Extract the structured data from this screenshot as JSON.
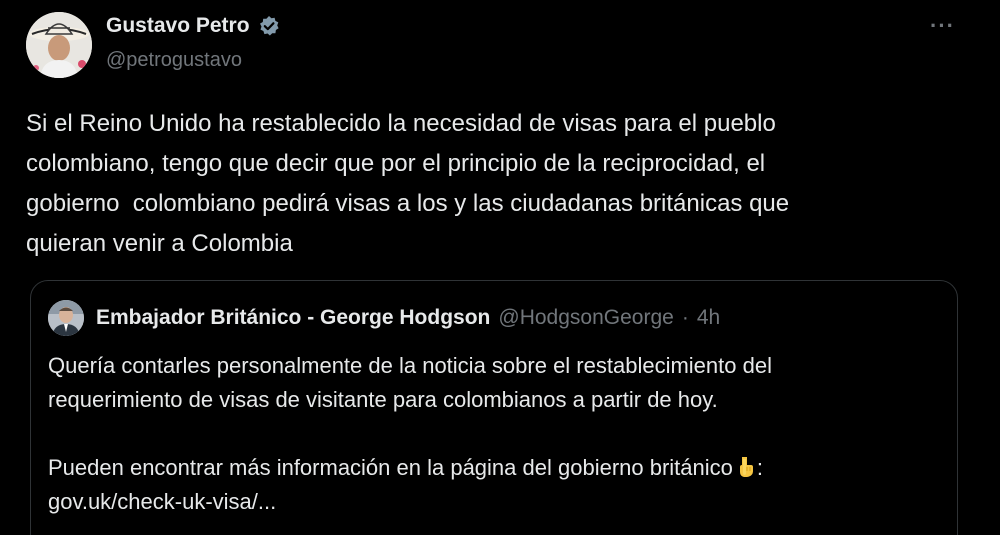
{
  "author": {
    "display_name": "Gustavo Petro",
    "handle": "@petrogustavo",
    "verified_icon": "verified-badge-icon"
  },
  "menu": {
    "more_label": "···"
  },
  "tweet": {
    "text": "Si el Reino Unido ha restablecido la necesidad de visas para el pueblo\ncolombiano, tengo que decir que por el principio de la reciprocidad, el\ngobierno  colombiano pedirá visas a los y las ciudadanas británicas que\nquieran venir a Colombia"
  },
  "quote": {
    "display_name": "Embajador Británico - George Hodgson",
    "handle": "@HodgsonGeorge",
    "separator": "·",
    "time": "4h",
    "paragraph1_line1": "Quería contarles personalmente de la noticia sobre el restablecimiento del",
    "paragraph1_line2": "requerimiento de visas de visitante para colombianos a partir de hoy.",
    "paragraph2_text": "Pueden encontrar más información en la página del gobierno británico",
    "paragraph2_emoji": "pointing-down-hand-icon",
    "paragraph2_colon": ":",
    "link_text": "gov.uk/check-uk-visa/..."
  },
  "colors": {
    "background": "#000000",
    "primary_text": "#e7e9ea",
    "secondary_text": "#71767b",
    "border": "#2f3336",
    "verified_blue": "#829aab"
  }
}
